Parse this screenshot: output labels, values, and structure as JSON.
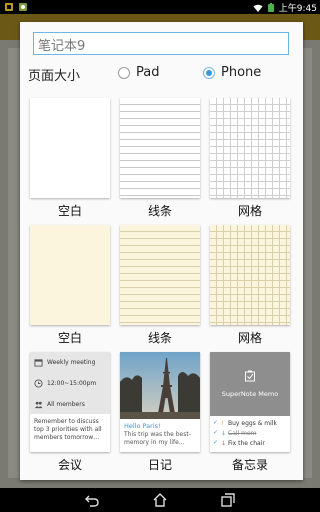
{
  "status_bar": {
    "time": "上午9:45",
    "icons": [
      "notification-icon",
      "app-icon",
      "wifi-icon",
      "battery-icon"
    ]
  },
  "dialog": {
    "name_input": {
      "value": "笔记本9"
    },
    "page_size": {
      "label": "页面大小",
      "options": [
        {
          "label": "Pad",
          "selected": false
        },
        {
          "label": "Phone",
          "selected": true
        }
      ]
    },
    "templates": [
      {
        "label": "空白",
        "style": "white-blank"
      },
      {
        "label": "线条",
        "style": "white-lines"
      },
      {
        "label": "网格",
        "style": "white-grid"
      },
      {
        "label": "空白",
        "style": "yellow-blank"
      },
      {
        "label": "线条",
        "style": "yellow-lines"
      },
      {
        "label": "网格",
        "style": "yellow-grid"
      },
      {
        "label": "会议",
        "style": "meeting"
      },
      {
        "label": "日记",
        "style": "diary"
      },
      {
        "label": "备忘录",
        "style": "memo"
      }
    ],
    "meeting_preview": {
      "title": "Weekly meeting",
      "time": "12:00~15:00pm",
      "attendees": "All members",
      "note": "Remember to discuss top 3 priorities with all members tomorrow…"
    },
    "diary_preview": {
      "title": "Hello Paris!",
      "text": "This trip was the best-memory in my life…"
    },
    "memo_preview": {
      "title": "SuperNote Memo",
      "items": [
        {
          "text": "Buy eggs & milk",
          "done": false
        },
        {
          "text": "Call mom",
          "done": true
        },
        {
          "text": "Fix the chair",
          "done": false
        }
      ]
    }
  },
  "nav_bar": {
    "buttons": [
      "back",
      "home",
      "recent-apps"
    ]
  },
  "colors": {
    "accent": "#3a97db",
    "dialog_bg": "#fafafa",
    "status_bar": "#000000"
  }
}
